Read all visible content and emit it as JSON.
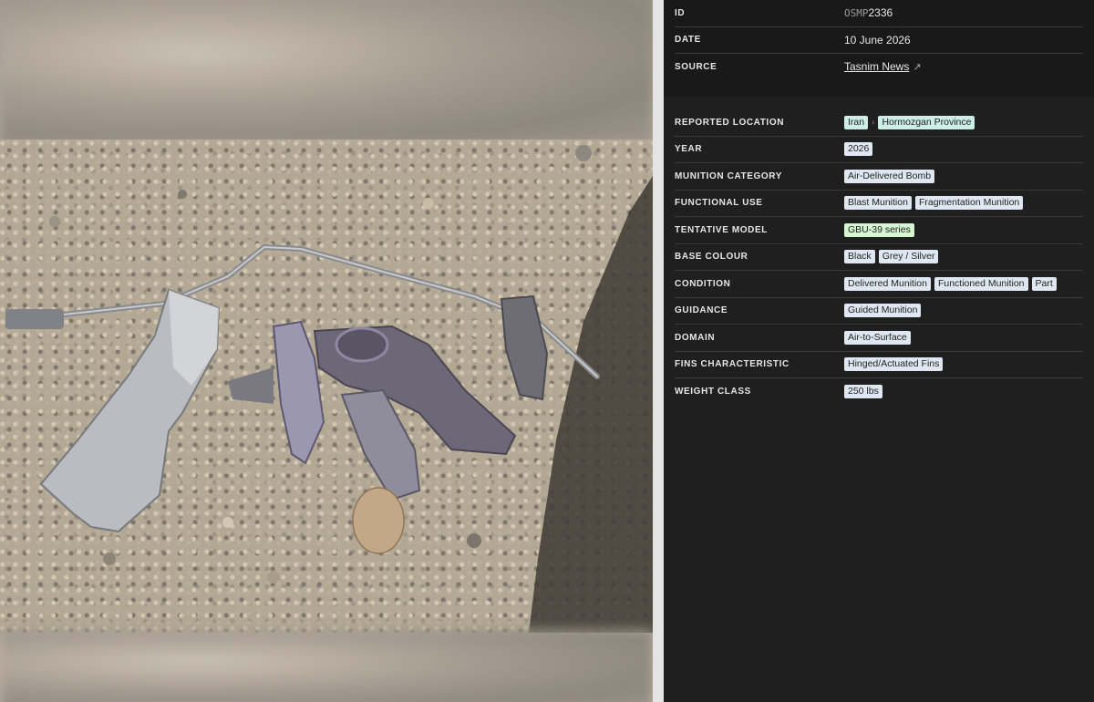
{
  "meta": {
    "id_label": "ID",
    "id_prefix": "OSMP",
    "id_number": "2336",
    "date_label": "DATE",
    "date_value": "10 June 2026",
    "source_label": "SOURCE",
    "source_value": "Tasnim News",
    "source_icon": "external-link-icon"
  },
  "attributes": {
    "location_label": "REPORTED LOCATION",
    "location_country": "Iran",
    "location_province": "Hormozgan Province",
    "location_separator": "›",
    "year_label": "YEAR",
    "year_value": "2026",
    "category_label": "MUNITION CATEGORY",
    "category_value": "Air-Delivered Bomb",
    "use_label": "FUNCTIONAL USE",
    "use_values": [
      "Blast Munition",
      "Fragmentation Munition"
    ],
    "model_label": "TENTATIVE MODEL",
    "model_value": "GBU-39 series",
    "colour_label": "BASE COLOUR",
    "colour_values": [
      "Black",
      "Grey / Silver"
    ],
    "condition_label": "CONDITION",
    "condition_values": [
      "Delivered Munition",
      "Functioned Munition",
      "Part"
    ],
    "guidance_label": "GUIDANCE",
    "guidance_value": "Guided Munition",
    "domain_label": "DOMAIN",
    "domain_value": "Air-to-Surface",
    "fins_label": "FINS CHARACTERISTIC",
    "fins_value": "Hinged/Actuated Fins",
    "weight_label": "WEIGHT CLASS",
    "weight_value": "250 lbs"
  },
  "colors": {
    "chip_blue": "#dfe8f2",
    "chip_teal": "#cdeee6",
    "chip_green": "#d6f5d3",
    "panel_bg": "#1f1f1f"
  }
}
